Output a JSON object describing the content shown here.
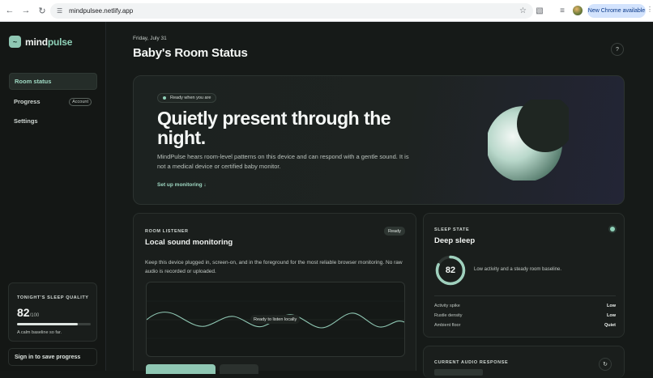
{
  "browser": {
    "url": "mindpulsee.netlify.app",
    "chrome_button": "New Chrome available"
  },
  "sidebar": {
    "logo_mind": "mind",
    "logo_pulse": "pulse",
    "items": [
      {
        "label": "Room status",
        "active": true
      },
      {
        "label": "Progress",
        "badge": "Account"
      },
      {
        "label": "Settings"
      }
    ],
    "sleep_quality": {
      "label": "TONIGHT'S SLEEP QUALITY",
      "score": "82",
      "max": "/100",
      "fraction": 0.82,
      "note": "A calm baseline so far."
    },
    "signin": "Sign in to save progress"
  },
  "header": {
    "date": "Friday, July 31",
    "title": "Baby's Room Status",
    "help": "?"
  },
  "hero": {
    "pill": "Ready when you are",
    "title": "Quietly present through the night.",
    "text": "MindPulse hears room-level patterns on this device and can respond with a gentle sound. It is not a medical device or certified baby monitor.",
    "link": "Set up monitoring ↓"
  },
  "listener": {
    "label": "ROOM LISTENER",
    "title": "Local sound monitoring",
    "badge": "Ready",
    "text": "Keep this device plugged in, screen-on, and in the foreground for the most reliable browser monitoring. No raw audio is recorded or uploaded.",
    "wave_label": "Ready to listen locally"
  },
  "sleep_state": {
    "label": "SLEEP STATE",
    "title": "Deep sleep",
    "score": "82",
    "score_fraction": 0.82,
    "desc": "Low activity and a steady room baseline.",
    "metrics": [
      {
        "name": "Activity spike",
        "value": "Low"
      },
      {
        "name": "Rustle density",
        "value": "Low"
      },
      {
        "name": "Ambient floor",
        "value": "Quiet"
      }
    ]
  },
  "audio_response": {
    "label": "CURRENT AUDIO RESPONSE"
  },
  "colors": {
    "accent": "#8fd1b8",
    "background": "#161a18"
  }
}
